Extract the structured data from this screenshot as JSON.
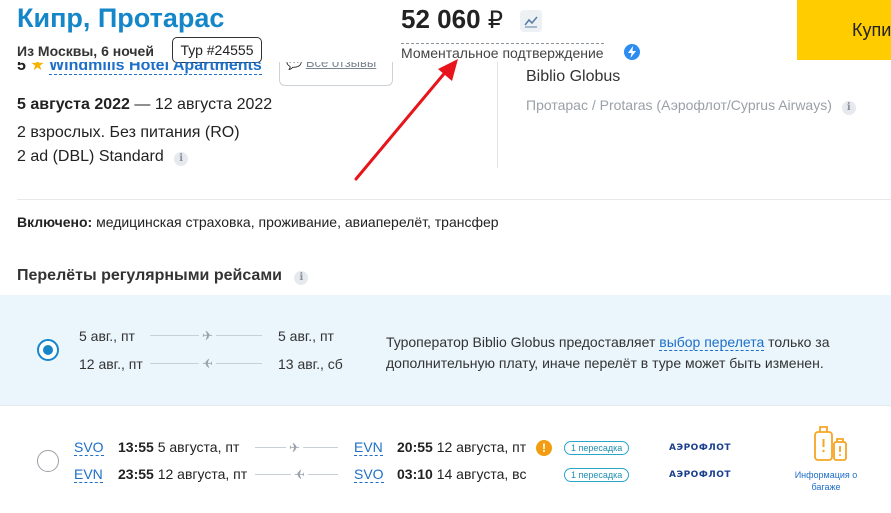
{
  "header": {
    "title": "Кипр, Протарас",
    "subtitle": "Из Москвы, 6 ночей",
    "tour_badge": "Тур #24555",
    "price": "52 060",
    "currency": "₽",
    "confirmation": "Моментальное подтверждение",
    "buy_button": "Купить"
  },
  "hotel": {
    "stars": "5",
    "name": "Windmills Hotel Apartments",
    "reviews_link": "Все отзывы",
    "date_from": "5 августа 2022",
    "date_sep": " — ",
    "date_to": "12 августа 2022",
    "guests": "2 взрослых. Без питания (RO)",
    "room": "2 ad (DBL) Standard"
  },
  "operator": {
    "name": "Biblio Globus",
    "route": "Протарас / Protaras (Аэрофлот/Cyprus Airways)"
  },
  "included": {
    "label": "Включено:",
    "text": " медицинская страховка, проживание, авиаперелёт, трансфер"
  },
  "flights": {
    "section_title": "Перелёты регулярными рейсами",
    "selected": {
      "out_from": "5 авг., пт",
      "out_to": "5 авг., пт",
      "back_from": "12 авг., пт",
      "back_to": "13 авг., сб",
      "note_pre": "Туроператор Biblio Globus предоставляет ",
      "note_link": "выбор перелета",
      "note_post": " только за",
      "note_line2": "дополнительную плату, иначе перелёт в туре может быть изменен."
    },
    "option": {
      "out": {
        "from_code": "SVO",
        "dep_time": "13:55",
        "dep_date": "5 августа, пт",
        "to_code": "EVN",
        "arr_time": "20:55",
        "arr_date": "12 августа, пт",
        "transfer": "1 пересадка",
        "airline": "АЭРОФЛОТ"
      },
      "back": {
        "from_code": "EVN",
        "dep_time": "23:55",
        "dep_date": "12 августа, пт",
        "to_code": "SVO",
        "arr_time": "03:10",
        "arr_date": "14 августа, вс",
        "transfer": "1 пересадка",
        "airline": "АЭРОФЛОТ"
      },
      "baggage_line1": "Информация о",
      "baggage_line2": "багаже",
      "warning_symbol": "!"
    }
  },
  "colors": {
    "title_blue": "#1587c9",
    "link_blue": "#1e6fc8",
    "buy_yellow": "#ffcc00",
    "selected_bg": "#eaf5fc",
    "arrow_red": "#e8141b",
    "lightning_blue": "#2d8cf0",
    "warning_orange": "#f39c12",
    "baggage_orange": "#f5a623"
  },
  "icons": {
    "chart": "trend-chart-icon",
    "lightning": "lightning-icon",
    "chat": "chat-bubble-icon",
    "plane": "airplane-icon",
    "info": "info-icon",
    "warning": "warning-icon",
    "baggage": "suitcase-icon"
  }
}
